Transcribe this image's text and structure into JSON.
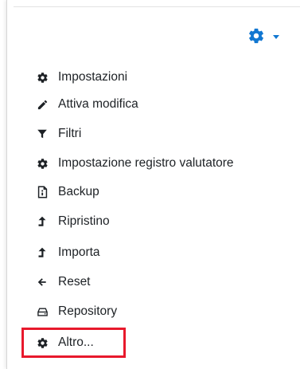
{
  "header": {
    "settings_icon": "gear-icon",
    "dropdown_icon": "caret-down-icon",
    "accent_color": "#1177d1"
  },
  "menu": {
    "items": [
      {
        "label": "Impostazioni",
        "icon": "gear-icon"
      },
      {
        "label": "Attiva modifica",
        "icon": "pencil-icon"
      },
      {
        "label": "Filtri",
        "icon": "filter-icon"
      },
      {
        "label": "Impostazione registro valutatore",
        "icon": "gear-icon"
      },
      {
        "label": "Backup",
        "icon": "backup-file-icon"
      },
      {
        "label": "Ripristino",
        "icon": "upload-arrow-icon"
      },
      {
        "label": "Importa",
        "icon": "upload-arrow-icon"
      },
      {
        "label": "Reset",
        "icon": "arrow-left-icon"
      },
      {
        "label": "Repository",
        "icon": "hard-drive-icon"
      },
      {
        "label": "Altro...",
        "icon": "gear-icon"
      }
    ]
  },
  "annotation": {
    "highlight_color": "#e8192c"
  }
}
